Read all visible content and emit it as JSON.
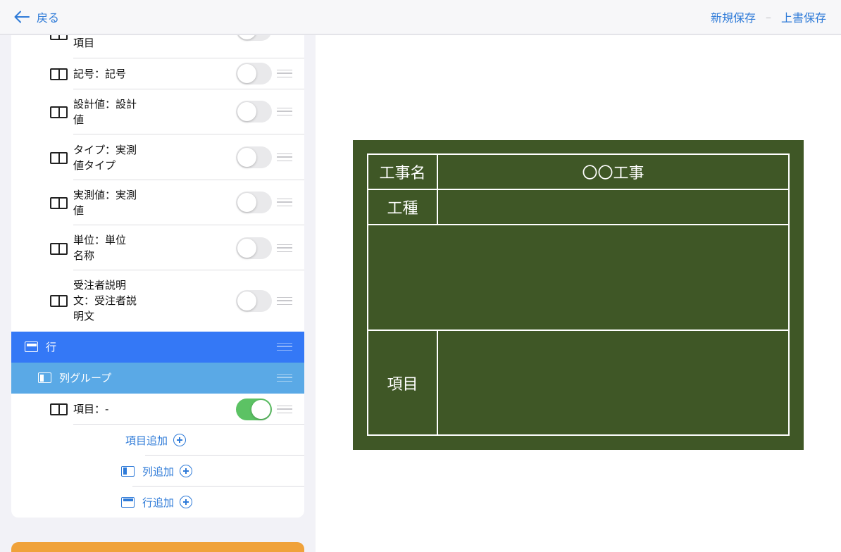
{
  "topbar": {
    "back_label": "戻る",
    "save_new_label": "新規保存",
    "separator": "–",
    "overwrite_label": "上書保存"
  },
  "items": [
    {
      "label": "項目"
    },
    {
      "label": "記号：記号"
    },
    {
      "label": "設計値：設計\n値"
    },
    {
      "label": "タイプ：実測\n値タイプ"
    },
    {
      "label": "実測値：実測\n値"
    },
    {
      "label": "単位：単位\n名称"
    },
    {
      "label": "受注者説明\n文：受注者説\n明文"
    }
  ],
  "row_header": {
    "label": "行"
  },
  "col_group_header": {
    "label": "列グループ"
  },
  "active_item": {
    "label": "項目：-",
    "toggle_on": true
  },
  "add_actions": {
    "add_item": "項目追加",
    "add_column": "列追加",
    "add_row": "行追加"
  },
  "board": {
    "background_color": "#3f5726",
    "rows": [
      {
        "label": "工事名",
        "value": "〇〇工事"
      },
      {
        "label": "工種",
        "value": ""
      },
      {
        "label": "",
        "value": ""
      },
      {
        "label": "項目",
        "value": ""
      }
    ]
  },
  "colors": {
    "accent": "#2f7bd8",
    "row_band": "#3478f6",
    "col_group_band": "#5aa9e6",
    "toggle_on": "#5cc264",
    "orange": "#f0a23a"
  }
}
